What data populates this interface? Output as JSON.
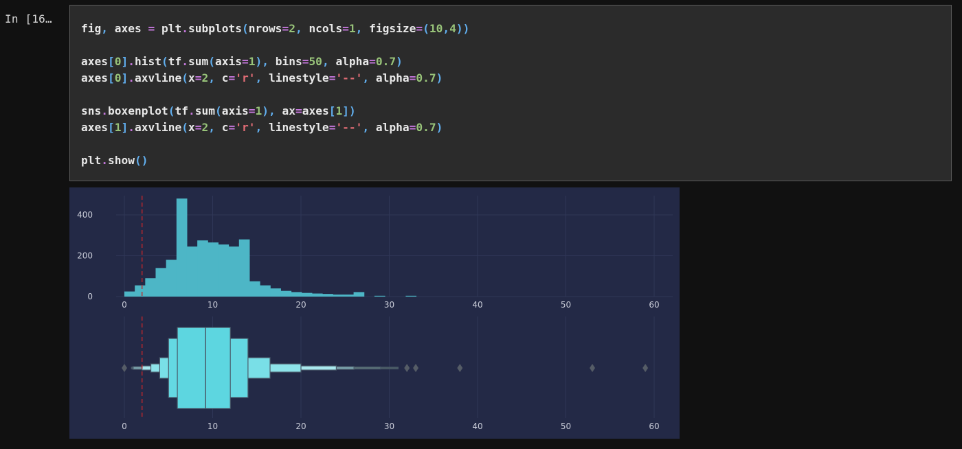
{
  "cell": {
    "prompt": "In [16…",
    "code_lines": [
      "fig, axes = plt.subplots(nrows=2, ncols=1, figsize=(10,4))",
      "",
      "axes[0].hist(tf.sum(axis=1), bins=50, alpha=0.7)",
      "axes[0].axvline(x=2, c='r', linestyle='--', alpha=0.7)",
      "",
      "sns.boxenplot(tf.sum(axis=1), ax=axes[1])",
      "axes[1].axvline(x=2, c='r', linestyle='--', alpha=0.7)",
      "",
      "plt.show()"
    ]
  },
  "colors": {
    "background": "#111111",
    "figure_bg": "#232946",
    "grid": "#2f3657",
    "bar": "#4db6c6",
    "box": "#5dd6e0",
    "box_edge": "#4a5a6a",
    "refline": "#c0282d",
    "outlier": "#555c66",
    "tick_text": "#c9ccd8"
  },
  "chart_data": [
    {
      "type": "bar",
      "subtype": "histogram",
      "xlim": [
        -1,
        62
      ],
      "ylim": [
        0,
        490
      ],
      "xticks": [
        0,
        10,
        20,
        30,
        40,
        50,
        60
      ],
      "yticks": [
        0,
        200,
        400
      ],
      "bin_width": 1.18,
      "bin_starts": [
        0,
        1.18,
        2.36,
        3.54,
        4.72,
        5.9,
        7.08,
        8.26,
        9.44,
        10.62,
        11.8,
        12.98,
        14.16,
        15.34,
        16.52,
        17.7,
        18.88,
        20.06,
        21.24,
        22.42,
        23.6,
        24.78,
        25.96,
        27.14,
        28.32,
        29.5,
        30.68,
        31.86
      ],
      "values": [
        25,
        55,
        90,
        140,
        180,
        480,
        245,
        275,
        265,
        255,
        245,
        280,
        75,
        55,
        40,
        28,
        22,
        18,
        15,
        13,
        10,
        10,
        22,
        0,
        4,
        0,
        0,
        4
      ],
      "refline": {
        "x": 2,
        "style": "dashed"
      }
    },
    {
      "type": "boxenplot",
      "xlim": [
        -1,
        62
      ],
      "xticks": [
        0,
        10,
        20,
        30,
        40,
        50,
        60
      ],
      "median": 9.2,
      "boxes": [
        {
          "lo": 6,
          "hi": 12,
          "color": "#5dd6e0"
        },
        {
          "lo": 5,
          "hi": 14,
          "color": "#64d8e2"
        },
        {
          "lo": 4,
          "hi": 16.5,
          "color": "#79dfe7"
        },
        {
          "lo": 3,
          "hi": 20,
          "color": "#8ee3ea"
        },
        {
          "lo": 2,
          "hi": 24,
          "color": "#a9e8ee"
        },
        {
          "lo": 1,
          "hi": 26,
          "color": "#7ba3ad"
        },
        {
          "lo": 0.9,
          "hi": 29,
          "color": "#5a7078"
        },
        {
          "lo": 0.8,
          "hi": 31,
          "color": "#4a5a62"
        }
      ],
      "outliers": [
        0,
        32,
        33,
        38,
        53,
        59
      ],
      "refline": {
        "x": 2,
        "style": "dashed"
      }
    }
  ]
}
